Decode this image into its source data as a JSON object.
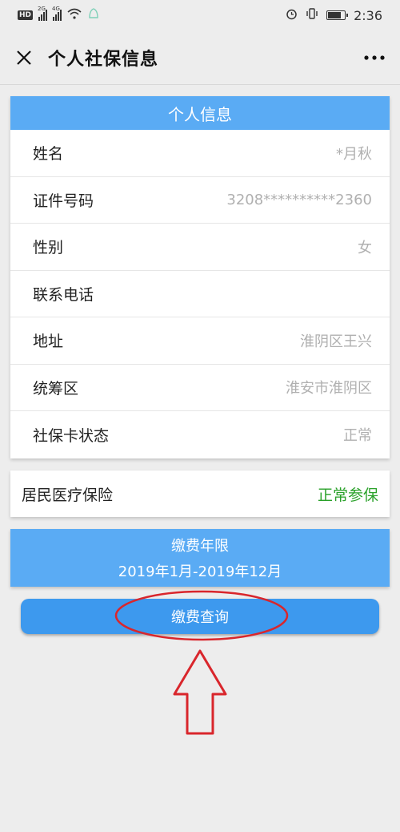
{
  "status_bar": {
    "network_badge": "HD",
    "signal_1_label": "2G",
    "signal_2_label": "4G",
    "time": "2:36"
  },
  "nav": {
    "title": "个人社保信息",
    "close_icon": "close-icon",
    "more_icon": "more-icon"
  },
  "info": {
    "header": "个人信息",
    "rows": [
      {
        "label": "姓名",
        "value": "*月秋"
      },
      {
        "label": "证件号码",
        "value": "3208**********2360"
      },
      {
        "label": "性别",
        "value": "女"
      },
      {
        "label": "联系电话",
        "value": ""
      },
      {
        "label": "地址",
        "value": "淮阴区王兴"
      },
      {
        "label": "统筹区",
        "value": "淮安市淮阴区"
      },
      {
        "label": "社保卡状态",
        "value": "正常"
      }
    ]
  },
  "insurance": {
    "name": "居民医疗保险",
    "status": "正常参保",
    "status_color": "#2aa12a"
  },
  "payment_period": {
    "title": "缴费年限",
    "range": "2019年1月-2019年12月"
  },
  "query_button": {
    "label": "缴费查询"
  },
  "colors": {
    "accent": "#5aabf4",
    "button": "#3d99ee",
    "annotation": "#d9262c"
  }
}
